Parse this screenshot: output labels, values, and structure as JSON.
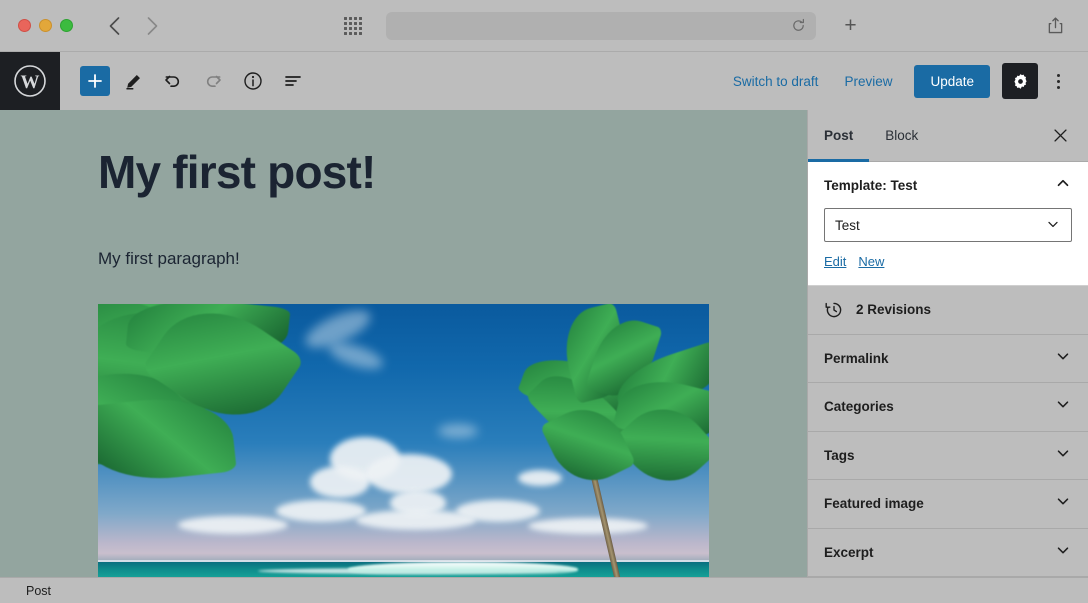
{
  "browser": {
    "traffic_lights": [
      "close",
      "minimize",
      "maximize"
    ],
    "back_icon": "chevron-left-icon",
    "forward_icon": "chevron-right-icon",
    "tabs_overview_icon": "grid-icon",
    "url_value": "",
    "url_placeholder": "",
    "reload_icon": "reload-icon",
    "new_tab_label": "+",
    "share_icon": "share-icon"
  },
  "header": {
    "logo": "wordpress-logo",
    "tools": [
      {
        "name": "add-block-button",
        "icon": "plus-icon",
        "state": "primary"
      },
      {
        "name": "tools-button",
        "icon": "pencil-icon",
        "state": "default"
      },
      {
        "name": "undo-button",
        "icon": "undo-icon",
        "state": "default"
      },
      {
        "name": "redo-button",
        "icon": "redo-icon",
        "state": "disabled"
      },
      {
        "name": "details-button",
        "icon": "info-icon",
        "state": "default"
      },
      {
        "name": "list-view-button",
        "icon": "list-view-icon",
        "state": "default"
      }
    ],
    "switch_to_draft_label": "Switch to draft",
    "preview_label": "Preview",
    "update_label": "Update",
    "settings_icon": "gear-icon",
    "options_icon": "kebab-menu-icon",
    "accent_color": "#1a6ba4",
    "dark_color": "#1d1f23"
  },
  "canvas": {
    "background_color": "#93a59f",
    "title": "My first post!",
    "paragraph": "My first paragraph!",
    "image_alt": "tropical-beach-painting-with-palm-trees"
  },
  "sidebar": {
    "tabs": [
      {
        "label": "Post",
        "active": true
      },
      {
        "label": "Block",
        "active": false
      }
    ],
    "close_icon": "close-icon",
    "template_panel": {
      "title": "Template: Test",
      "chevron": "chevron-up-icon",
      "select_value": "Test",
      "select_chevron": "chevron-down-icon",
      "edit_label": "Edit",
      "new_label": "New"
    },
    "rows": [
      {
        "label": "2 Revisions",
        "icon": "revisions-clock-icon",
        "chevron": ""
      },
      {
        "label": "Permalink",
        "icon": "",
        "chevron": "chevron-down-icon"
      },
      {
        "label": "Categories",
        "icon": "",
        "chevron": "chevron-down-icon"
      },
      {
        "label": "Tags",
        "icon": "",
        "chevron": "chevron-down-icon"
      },
      {
        "label": "Featured image",
        "icon": "",
        "chevron": "chevron-down-icon"
      },
      {
        "label": "Excerpt",
        "icon": "",
        "chevron": "chevron-down-icon"
      }
    ]
  },
  "status_bar": {
    "breadcrumb": "Post"
  }
}
